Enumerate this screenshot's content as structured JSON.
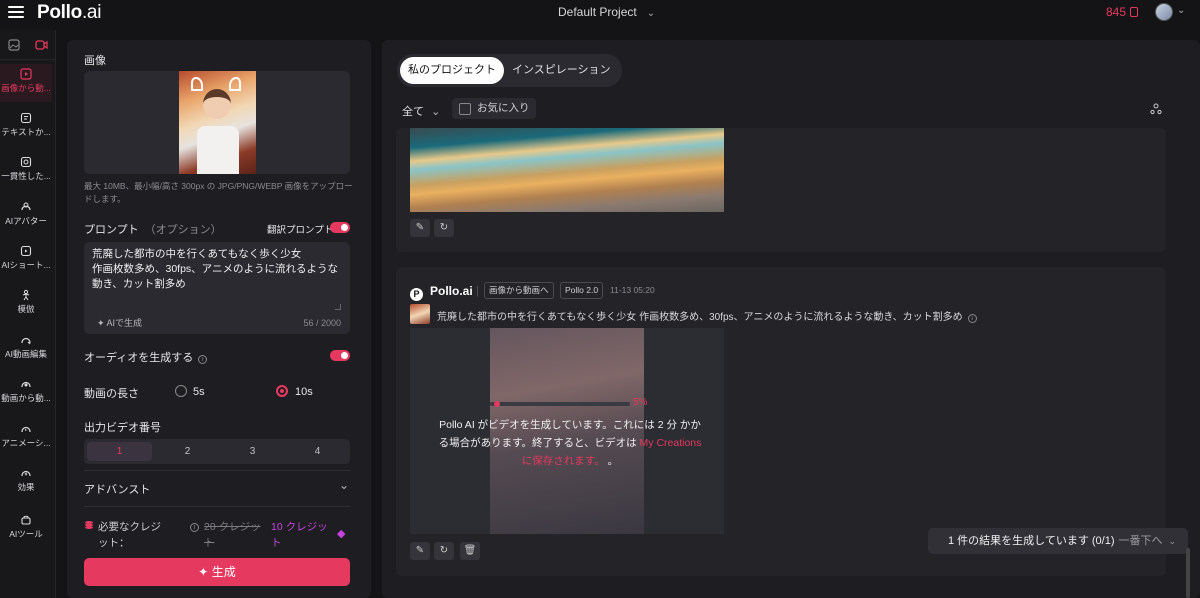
{
  "app": {
    "logo_brand": "Pollo",
    "logo_ai": ".ai",
    "project": "Default Project",
    "credits": "845"
  },
  "sidebar": {
    "items": [
      {
        "label": "画像から動...",
        "icon": "image-to-video-icon"
      },
      {
        "label": "テキストか...",
        "icon": "text-to-video-icon"
      },
      {
        "label": "一貫性した...",
        "icon": "consistent-video-icon"
      },
      {
        "label": "AIアバター",
        "icon": "ai-avatar-icon"
      },
      {
        "label": "AIショート...",
        "icon": "ai-short-icon"
      },
      {
        "label": "模倣",
        "icon": "imitate-icon"
      },
      {
        "label": "AI動画編集",
        "icon": "ai-video-edit-icon"
      },
      {
        "label": "動画から動...",
        "icon": "video-to-video-icon"
      },
      {
        "label": "アニメーシ...",
        "icon": "animation-icon"
      },
      {
        "label": "効果",
        "icon": "effects-icon"
      },
      {
        "label": "AIツール",
        "icon": "ai-tools-icon"
      }
    ]
  },
  "form": {
    "image_label": "画像",
    "upload_hint": "最大 10MB、最小幅/高さ 300px の JPG/PNG/WEBP 画像をアップロードします。",
    "prompt_label": "プロンプト",
    "prompt_optional": "（オプション）",
    "translate_label": "翻訳プロンプト",
    "prompt_text": "荒廃した都市の中を行くあてもなく歩く少女\n作画枚数多め、30fps、アニメのように流れるような動き、カット割多め",
    "ai_generate": "AIで生成",
    "char_count": "56 / 2000",
    "audio_label": "オーディオを生成する",
    "duration_label": "動画の長さ",
    "duration_5": "5s",
    "duration_10": "10s",
    "output_label": "出力ビデオ番号",
    "output_options": [
      "1",
      "2",
      "3",
      "4"
    ],
    "advanced_label": "アドバンスト",
    "credits_required": "必要なクレジット：",
    "credits_old": "20 クレジット",
    "credits_new": "10 クレジット",
    "generate_button": "生成"
  },
  "main": {
    "tab_projects": "私のプロジェクト",
    "tab_inspiration": "インスピレーション",
    "filter_all": "全て",
    "favorites": "お気に入り",
    "card": {
      "brand": "Pollo.ai",
      "mode_chip": "画像から動画へ",
      "model_chip": "Pollo 2.0",
      "timestamp": "11-13 05:20",
      "prompt": "荒廃した都市の中を行くあてもなく歩く少女 作画枚数多め、30fps、アニメのように流れるような動き、カット割多め",
      "progress_pct": "5%",
      "progress_value": 0.05,
      "msg_part1": "Pollo AI がビデオを生成しています。これには 2 分 かかる場合があります。終了すると、ビデオは ",
      "msg_link": "My Creations に保存されます。",
      "msg_end": " 。"
    }
  },
  "toast": {
    "text": "1 件の結果を生成しています (0/1)",
    "action": "一番下へ"
  },
  "colors": {
    "accent": "#e6395f",
    "bg": "#141416",
    "panel": "#1e1e22"
  }
}
